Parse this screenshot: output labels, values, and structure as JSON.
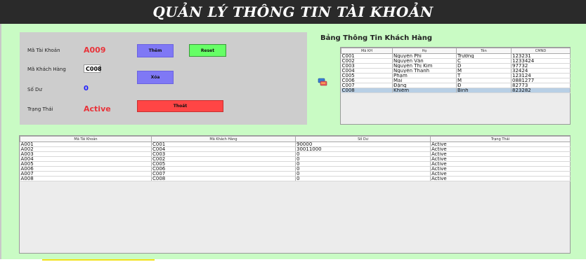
{
  "app": {
    "title": "QUẢN LÝ THÔNG TIN TÀI KHOẢN"
  },
  "form": {
    "account_id_label": "Mã Tài Khoản",
    "account_id_value": "A009",
    "customer_id_label": "Mã Khách Hàng",
    "customer_id_value": "C008",
    "balance_label": "Số Dư",
    "balance_value": "0",
    "status_label": "Trạng Thái",
    "status_value": "Active"
  },
  "buttons": {
    "add": "Thêm",
    "reset": "Reset",
    "delete": "Xóa",
    "exit": "Thoát"
  },
  "customer_table": {
    "heading": "Bảng Thông Tin Khách Hàng",
    "columns": [
      "Mã KH",
      "Họ",
      "Tên",
      "CMND"
    ],
    "rows": [
      [
        "C001",
        "Nguyễn Phi",
        "Trường",
        "123231"
      ],
      [
        "C002",
        "Nguyễn Văn",
        "C",
        "1233424"
      ],
      [
        "C003",
        "Nguyễn Thị Kim",
        "D",
        "97732"
      ],
      [
        "C004",
        "Nguyễn Thanh",
        "M",
        "32424"
      ],
      [
        "C005",
        "Phạm",
        "T",
        "123124"
      ],
      [
        "C006",
        "Mai",
        "M",
        "0881277"
      ],
      [
        "C007",
        "Đặng",
        "Đ",
        "82773"
      ],
      [
        "C008",
        "Khiêm",
        "Bình",
        "823282"
      ]
    ],
    "selected_row": 7
  },
  "account_table": {
    "columns": [
      "Mã Tài Khoản",
      "Mã Khách Hàng",
      "Số Dư",
      "Trạng Thái"
    ],
    "rows": [
      [
        "A001",
        "C001",
        "90000",
        "Active"
      ],
      [
        "A002",
        "C004",
        "30011000",
        "Active"
      ],
      [
        "A003",
        "C003",
        "0",
        "Active"
      ],
      [
        "A004",
        "C002",
        "0",
        "Active"
      ],
      [
        "A005",
        "C005",
        "0",
        "Active"
      ],
      [
        "A006",
        "C006",
        "0",
        "Active"
      ],
      [
        "A007",
        "C007",
        "0",
        "Active"
      ],
      [
        "A008",
        "C008",
        "0",
        "Active"
      ]
    ]
  },
  "icons": {
    "transfer": "transfer-icon"
  },
  "colors": {
    "background": "#c9fbc4",
    "panel": "#cdcdcd",
    "titlebar": "#2a2a2a",
    "value_red": "#e8333a",
    "value_blue": "#1a1aff",
    "button_blue": "#7f78f5",
    "button_green": "#66ff66",
    "button_red": "#ff4545",
    "selected_row": "#b8cfe5"
  }
}
